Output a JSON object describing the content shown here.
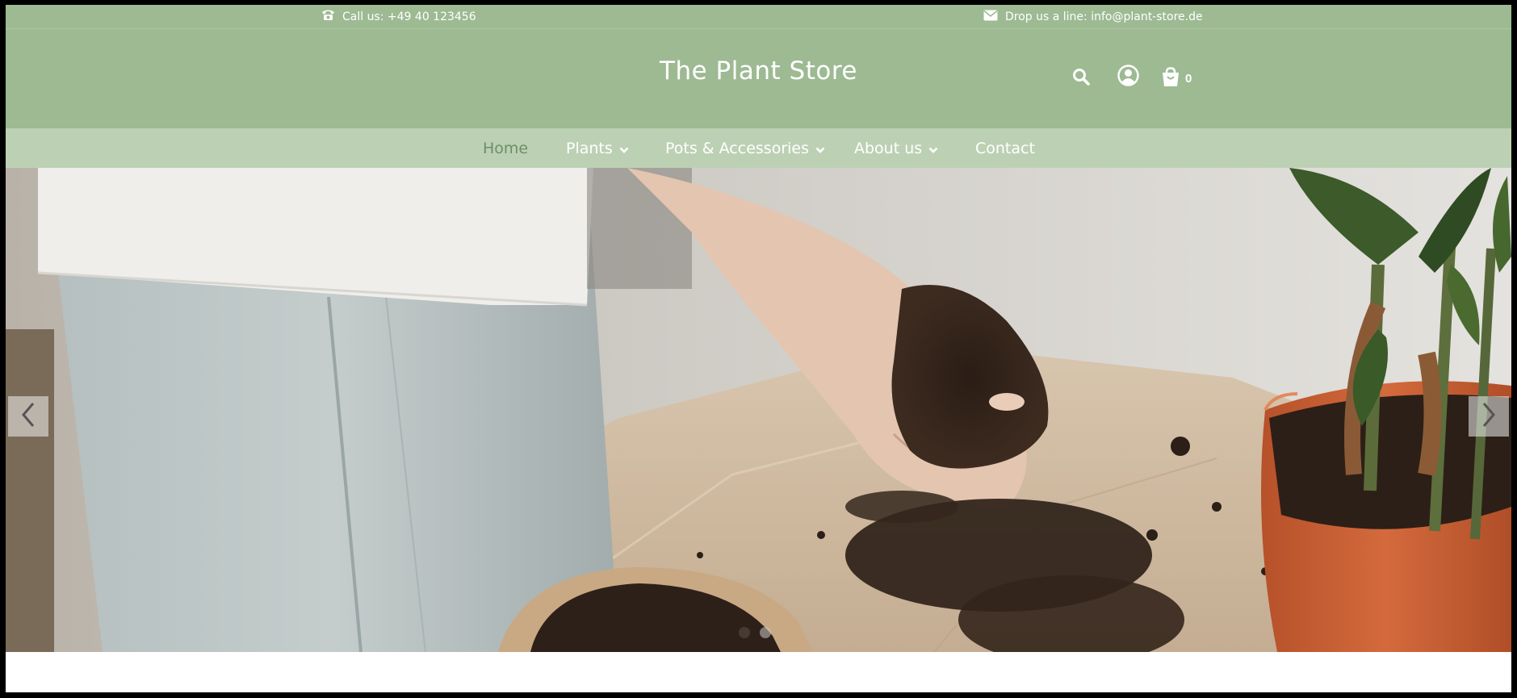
{
  "topbar": {
    "phone_icon": "phone-icon",
    "phone_text": "Call us: +49 40 123456",
    "mail_icon": "envelope-icon",
    "mail_text": "Drop us a line: info@plant-store.de"
  },
  "header": {
    "logo_text": "The Plant Store",
    "search_icon": "search-icon",
    "account_icon": "user-circle-icon",
    "cart_icon": "shopping-bag-icon",
    "cart_count": "0"
  },
  "nav": {
    "items": [
      {
        "label": "Home",
        "active": true,
        "has_dropdown": false
      },
      {
        "label": "Plants",
        "active": false,
        "has_dropdown": true
      },
      {
        "label": "Pots & Accessories",
        "active": false,
        "has_dropdown": true
      },
      {
        "label": "About us",
        "active": false,
        "has_dropdown": true
      },
      {
        "label": "Contact",
        "active": false,
        "has_dropdown": false
      }
    ]
  },
  "slider": {
    "prev_icon": "chevron-left-icon",
    "next_icon": "chevron-right-icon",
    "slide_count": 2,
    "active_slide": 2
  },
  "colors": {
    "header_green": "#9dba93",
    "nav_green": "#bcd1b3",
    "active_link": "#6d8f67",
    "text_white": "#ffffff"
  }
}
